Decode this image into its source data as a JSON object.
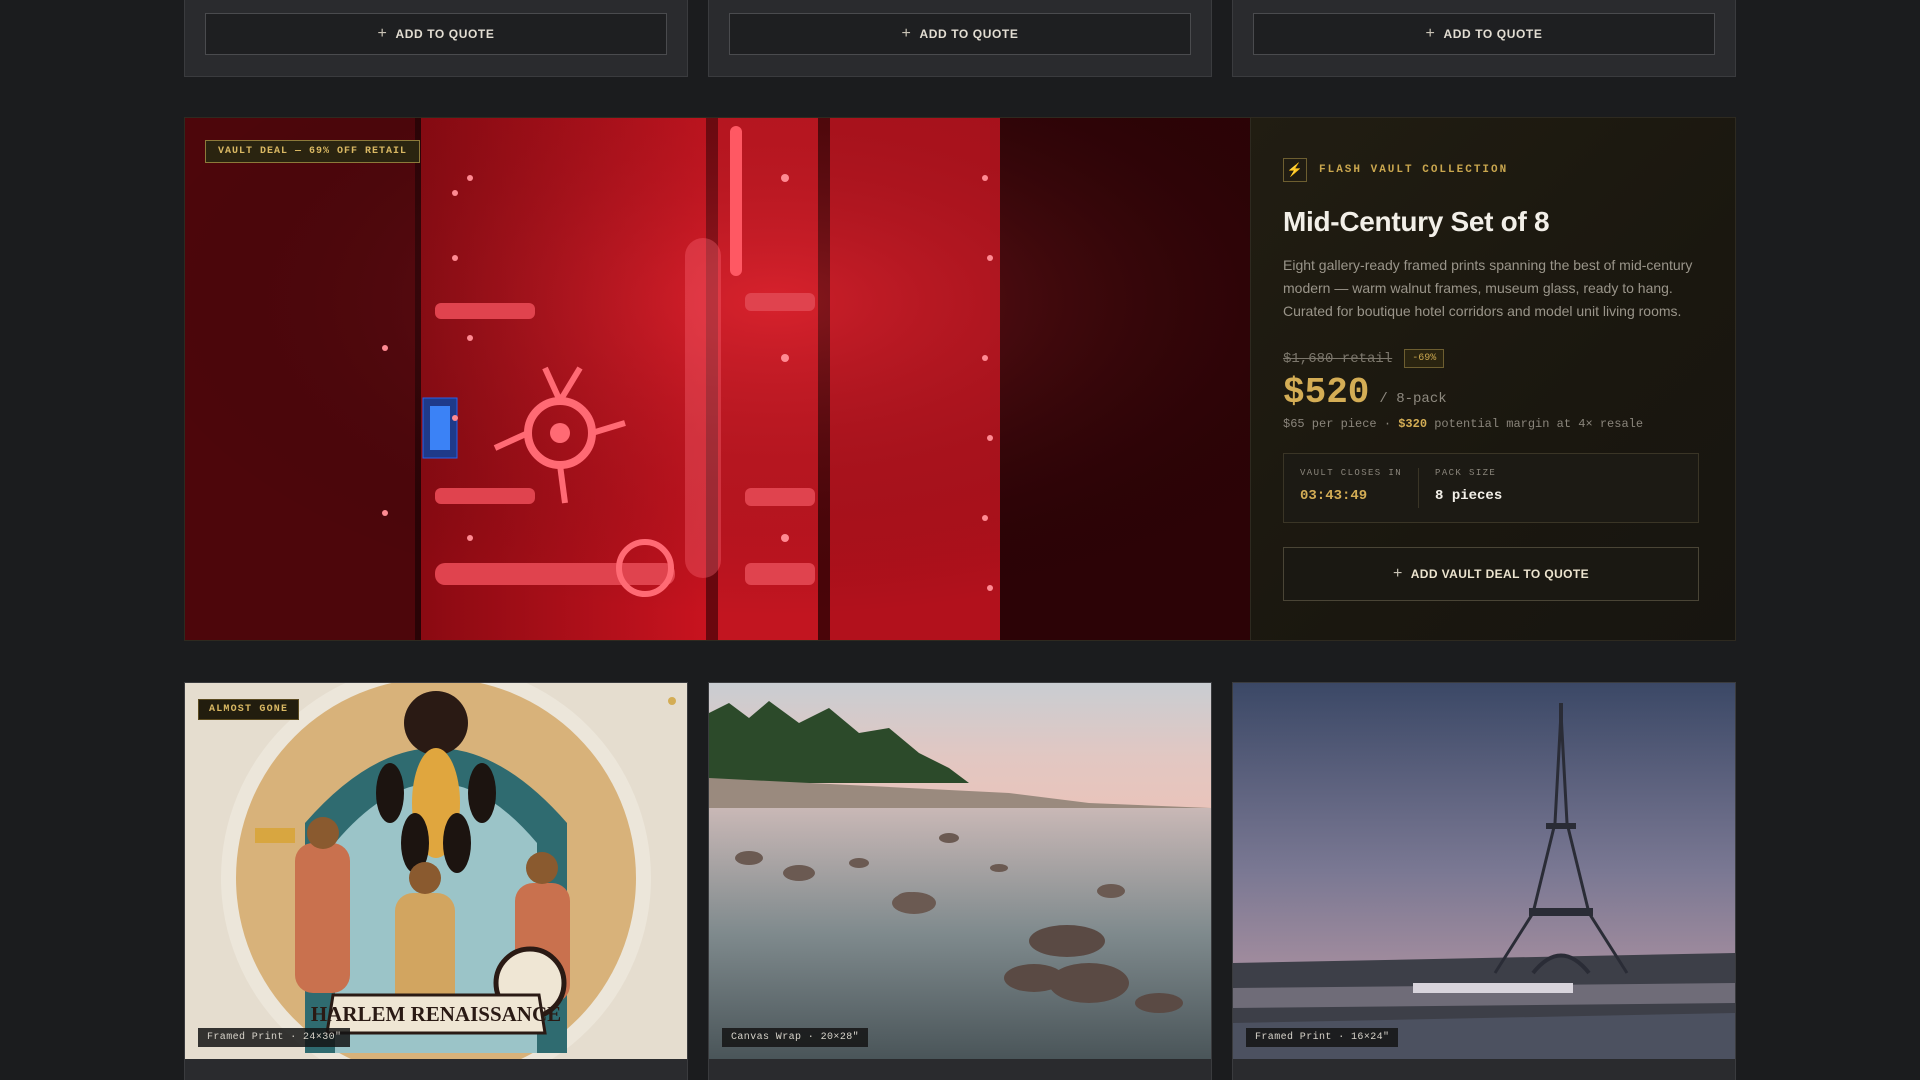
{
  "top_cards": [
    {
      "quote_label": "ADD TO QUOTE"
    },
    {
      "quote_label": "ADD TO QUOTE"
    },
    {
      "quote_label": "ADD TO QUOTE"
    }
  ],
  "vault_deal": {
    "badge": "VAULT DEAL — 69% OFF RETAIL",
    "collection_icon": "bolt-icon",
    "collection": "FLASH VAULT COLLECTION",
    "title": "Mid-Century Set of 8",
    "description": "Eight gallery-ready framed prints spanning the best of mid-century modern — warm walnut frames, museum glass, ready to hang. Curated for boutique hotel corridors and model unit living rooms.",
    "retail": "$1,680 retail",
    "discount": "-69%",
    "price": "$520",
    "pack": "/ 8-pack",
    "per_piece": "$65 per piece · ",
    "margin_value": "$320",
    "margin_text": " potential margin at 4× resale",
    "closes_label": "VAULT CLOSES IN",
    "countdown": "03:43:49",
    "pack_size_label": "PACK SIZE",
    "pack_size": "8 pieces",
    "cta": "ADD VAULT DEAL TO QUOTE"
  },
  "products": [
    {
      "badge": "ALMOST GONE",
      "spec": "Framed Print · 24×30\"",
      "art_title": "HARLEM RENAISSANCE"
    },
    {
      "spec": "Canvas Wrap · 20×28\""
    },
    {
      "spec": "Framed Print · 16×24\""
    }
  ],
  "colors": {
    "accent_gold": "#d4ad55",
    "vault_red": "#c81421",
    "bg": "#1b1c1e"
  }
}
